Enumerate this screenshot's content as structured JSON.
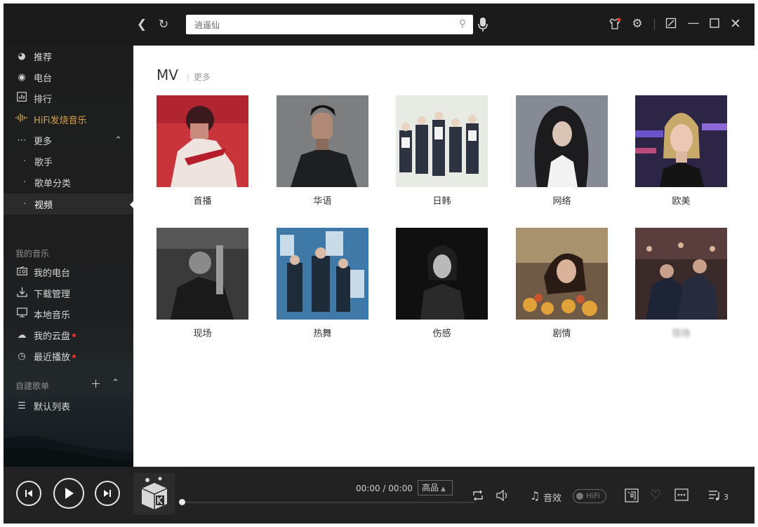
{
  "search": {
    "value": "逍遥仙",
    "placeholder": "逍遥仙"
  },
  "sidebar": {
    "items": [
      {
        "label": "推荐",
        "icon": "disc-icon"
      },
      {
        "label": "电台",
        "icon": "radio-icon"
      },
      {
        "label": "排行",
        "icon": "chart-icon"
      },
      {
        "label": "HiFi发烧音乐",
        "icon": "soundwave-icon"
      },
      {
        "label": "更多",
        "icon": "more-dots-icon"
      }
    ],
    "sub_items": [
      {
        "label": "歌手"
      },
      {
        "label": "歌单分类"
      },
      {
        "label": "视频"
      }
    ],
    "my_music_heading": "我的音乐",
    "my_music": [
      {
        "label": "我的电台",
        "icon": "radio-box-icon"
      },
      {
        "label": "下载管理",
        "icon": "download-icon"
      },
      {
        "label": "本地音乐",
        "icon": "monitor-icon"
      },
      {
        "label": "我的云盘",
        "icon": "cloud-icon"
      },
      {
        "label": "最近播放",
        "icon": "clock-icon"
      }
    ],
    "playlists_heading": "自建歌单",
    "playlists": [
      {
        "label": "默认列表",
        "icon": "list-icon"
      }
    ]
  },
  "main": {
    "title": "MV",
    "more_label": "更多",
    "cards": [
      {
        "label": "首播"
      },
      {
        "label": "华语"
      },
      {
        "label": "日韩"
      },
      {
        "label": "网络"
      },
      {
        "label": "欧美"
      },
      {
        "label": "现场"
      },
      {
        "label": "热舞"
      },
      {
        "label": "伤感"
      },
      {
        "label": "剧情"
      },
      {
        "label": "现场"
      }
    ]
  },
  "player": {
    "time": "00:00 / 00:00",
    "quality": "高品",
    "effects_label": "音效",
    "hifi_label": "HiFi",
    "queue_count": "3",
    "progress": 0
  },
  "colors": {
    "accent_gold": "#d6a24a",
    "notify_red": "#e0312b",
    "sidebar_bg": "#1d1d1d",
    "player_bg": "#222222"
  }
}
